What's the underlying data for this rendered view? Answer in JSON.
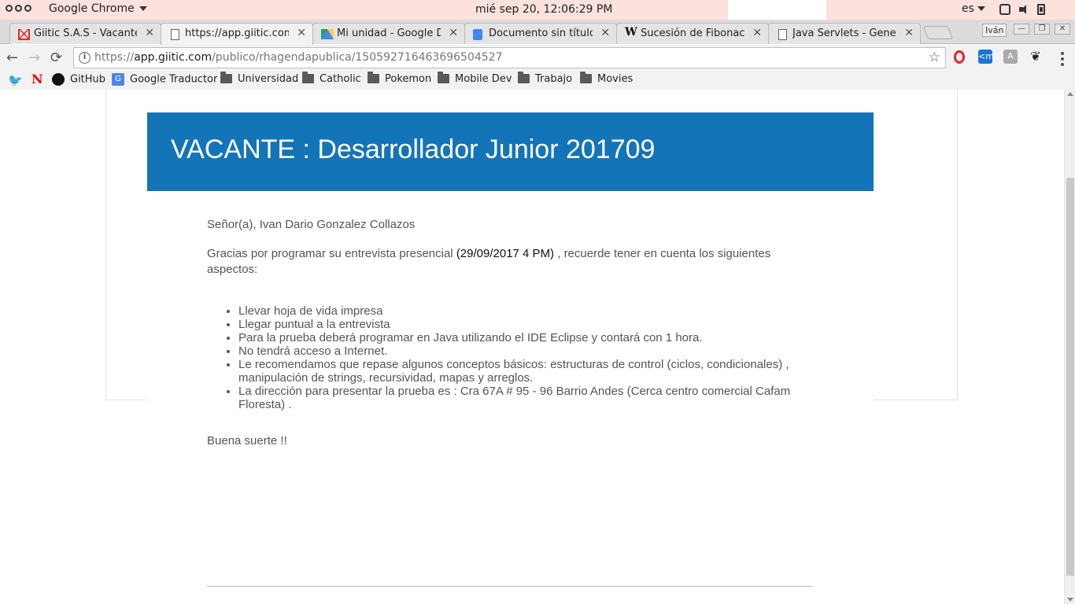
{
  "system_bar": {
    "app_name": "Google Chrome",
    "clock": "mié sep 20, 12:06:29 PM",
    "language": "es"
  },
  "tabs": [
    {
      "label": "Giitic S.A.S - Vacante :",
      "icon": "gmail-icon",
      "active": false
    },
    {
      "label": "https://app.giitic.com/p",
      "icon": "page-icon",
      "active": true
    },
    {
      "label": "Mi unidad - Google Dri",
      "icon": "google-drive-icon",
      "active": false
    },
    {
      "label": "Documento sin título -",
      "icon": "google-docs-icon",
      "active": false
    },
    {
      "label": "Sucesión de Fibonacci",
      "icon": "wikipedia-icon",
      "active": false
    },
    {
      "label": "Java Servlets - Genera",
      "icon": "page-icon",
      "active": false
    }
  ],
  "window": {
    "user": "Iván",
    "minimize": "—",
    "restore": "❐",
    "close": "✕"
  },
  "toolbar": {
    "back": "←",
    "forward": "→",
    "reload": "⟳",
    "url_scheme": "https://",
    "url_host": "app.giitic.com",
    "url_path": "/publico/rhagendapublica/150592716463696504527",
    "star": "☆"
  },
  "bookmarks": [
    {
      "label": "GitHub",
      "icon": "github-icon"
    },
    {
      "label": "Google Traductor",
      "icon": "google-translate-icon"
    },
    {
      "label": "Universidad",
      "icon": "folder-icon"
    },
    {
      "label": "Catholic",
      "icon": "folder-icon"
    },
    {
      "label": "Pokemon",
      "icon": "folder-icon"
    },
    {
      "label": "Mobile Dev",
      "icon": "folder-icon"
    },
    {
      "label": "Trabajo",
      "icon": "folder-icon"
    },
    {
      "label": "Movies",
      "icon": "folder-icon"
    }
  ],
  "page": {
    "title": "VACANTE : Desarrollador Junior 201709",
    "greeting": "Señor(a), Ivan Dario Gonzalez Collazos",
    "intro_before": "Gracias por programar su entrevista presencial ",
    "intro_date": "(29/09/2017   4 PM)",
    "intro_after": " ,  recuerde tener en cuenta los siguientes aspectos:",
    "items": [
      "Llevar hoja de vida impresa",
      "Llegar puntual a la entrevista",
      "Para la prueba deberá programar en Java utilizando el IDE Eclipse y contará con 1 hora.",
      "No tendrá acceso a Internet.",
      "Le recomendamos que repase algunos conceptos básicos: estructuras de control (ciclos, condicionales) , manipulación de strings, recursividad, mapas y arreglos.",
      "La dirección para presentar la prueba es : Cra 67A # 95 - 96 Barrio Andes (Cerca centro comercial Cafam Floresta) ."
    ],
    "closing": "Buena suerte !!"
  },
  "colors": {
    "header_band": "#1474b8",
    "system_bar": "#fbe2dc"
  }
}
